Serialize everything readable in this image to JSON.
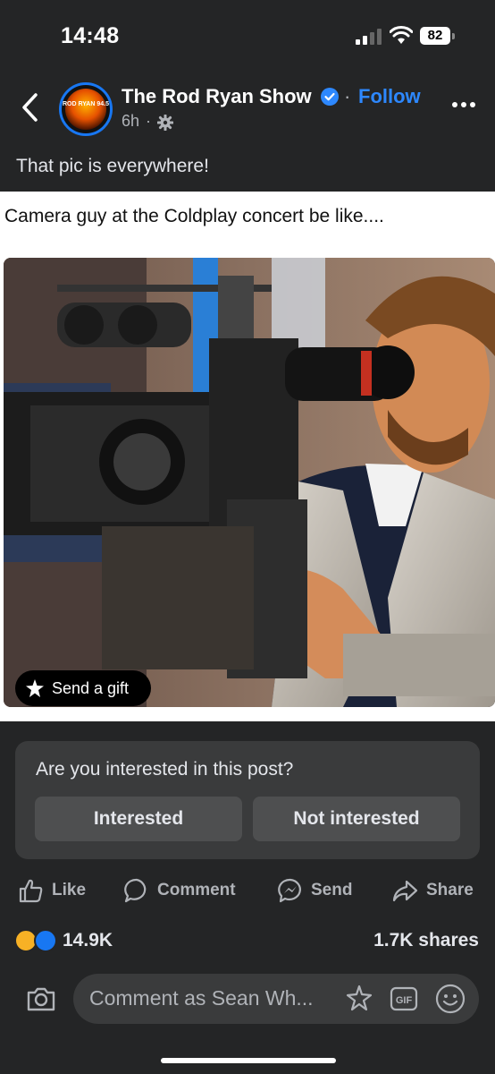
{
  "status_bar": {
    "time": "14:48",
    "battery": "82"
  },
  "header": {
    "page_name": "The Rod Ryan Show",
    "dot": "·",
    "follow": "Follow",
    "post_age": "6h",
    "time_dot": "·",
    "avatar_text": "ROD RYAN 94.5"
  },
  "post": {
    "caption": "That pic is everywhere!",
    "text": "Camera guy at the Coldplay concert be like....",
    "gift_label": "Send a gift"
  },
  "interest_card": {
    "question": "Are you interested in this post?",
    "interested": "Interested",
    "not_interested": "Not interested"
  },
  "actions": {
    "like": "Like",
    "comment": "Comment",
    "send": "Send",
    "share": "Share"
  },
  "engagement": {
    "reactions": "14.9K",
    "shares": "1.7K shares"
  },
  "composer": {
    "placeholder": "Comment as Sean Wh..."
  },
  "colors": {
    "background": "#242526",
    "accent": "#2d88ff",
    "card": "#3a3b3c"
  }
}
